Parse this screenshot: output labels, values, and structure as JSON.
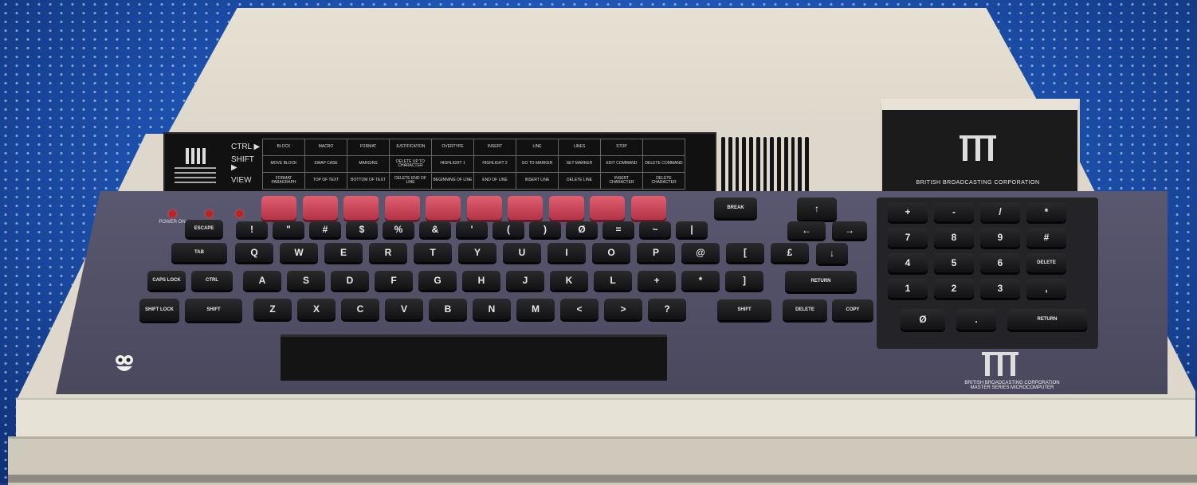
{
  "strip": {
    "rows": [
      {
        "label": "CTRL ▶",
        "cells": [
          "BLOCK",
          "MACRO",
          "FORMAT",
          "JUSTIFICATION",
          "OVERTYPE",
          "INSERT",
          "LINE",
          "LINES",
          "STOP",
          "",
          "",
          ""
        ]
      },
      {
        "label": "SHIFT ▶",
        "cells": [
          "MOVE BLOCK",
          "SWAP CASE",
          "MARGINS",
          "DELETE UP TO CHARACTER",
          "HIGHLIGHT 1",
          "HIGHLIGHT 2",
          "GO TO MARKER",
          "SET MARKER",
          "EDIT COMMAND",
          "DELETE COMMAND",
          "",
          ""
        ]
      },
      {
        "label": "VIEW",
        "cells": [
          "FORMAT PARAGRAPH",
          "TOP OF TEXT",
          "BOTTOM OF TEXT",
          "DELETE END OF LINE",
          "BEGINNING OF LINE",
          "END OF LINE",
          "INSERT LINE",
          "DELETE LINE",
          "INSERT CHARACTER",
          "DELETE CHARACTER",
          "",
          ""
        ]
      }
    ]
  },
  "leds": [
    "POWER ON",
    "",
    ""
  ],
  "keys": {
    "row_esc": [
      "ESCAPE",
      "!",
      "\"",
      "#",
      "$",
      "%",
      "&",
      "'",
      "(",
      ")",
      "Ø",
      "=",
      "~",
      "|",
      "BREAK"
    ],
    "row_q": [
      "TAB",
      "Q",
      "W",
      "E",
      "R",
      "T",
      "Y",
      "U",
      "I",
      "O",
      "P",
      "@",
      "[",
      "£",
      "↓"
    ],
    "row_a": [
      "CAPS LOCK",
      "CTRL",
      "A",
      "S",
      "D",
      "F",
      "G",
      "H",
      "J",
      "K",
      "L",
      "+",
      "*",
      "]",
      "RETURN"
    ],
    "row_z": [
      "SHIFT LOCK",
      "SHIFT",
      "Z",
      "X",
      "C",
      "V",
      "B",
      "N",
      "M",
      "<",
      ">",
      "?",
      "SHIFT",
      "DELETE",
      "COPY"
    ],
    "arrows": [
      "↑",
      "←",
      "→"
    ],
    "keypad": [
      [
        "+",
        "-",
        "/",
        "*"
      ],
      [
        "7",
        "8",
        "9",
        "#"
      ],
      [
        "4",
        "5",
        "6",
        "DELETE"
      ],
      [
        "1",
        "2",
        "3",
        ","
      ],
      [
        "Ø",
        ".",
        "RETURN"
      ]
    ]
  },
  "cartridge": {
    "text": "BRITISH BROADCASTING CORPORATION"
  },
  "badge": {
    "line1": "BRITISH BROADCASTING CORPORATION",
    "line2": "MASTER SERIES MICROCOMPUTER"
  }
}
